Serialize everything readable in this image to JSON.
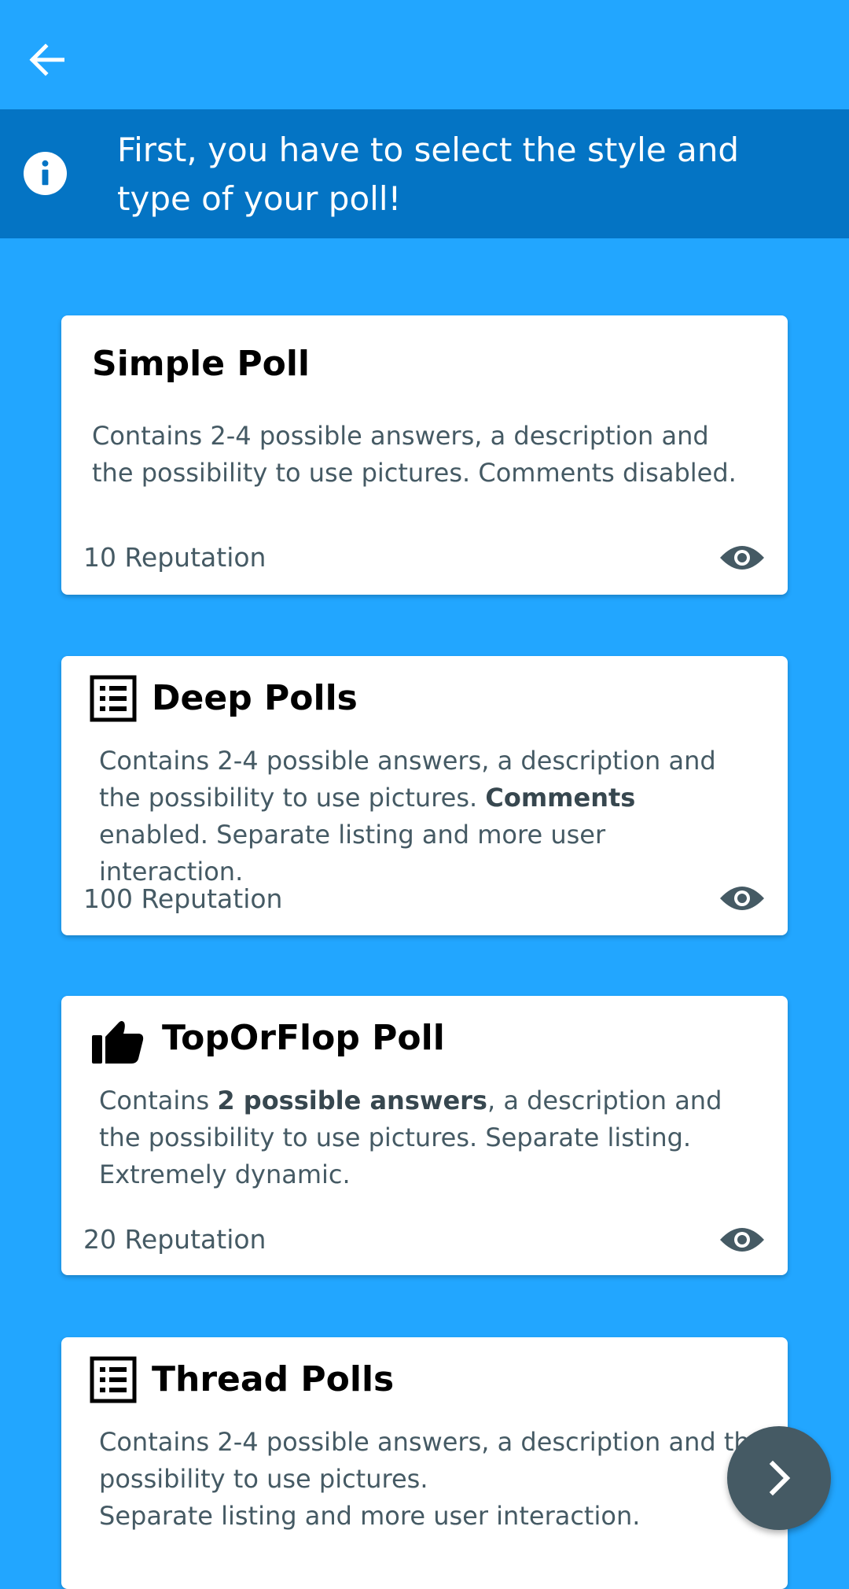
{
  "banner": {
    "text": "First, you have to select the style and type of your poll!"
  },
  "cards": [
    {
      "title": "Simple Poll",
      "description": "Contains 2-4 possible answers, a description and the possibility to use pictures. Comments disabled.",
      "reputation": "10 Reputation"
    },
    {
      "title": "Deep Polls",
      "description_parts": [
        "Contains 2-4 possible answers, a description and the possibility to use pictures. ",
        "Comments",
        " enabled. Separate listing and more user interaction."
      ],
      "reputation": "100 Reputation"
    },
    {
      "title": "TopOrFlop Poll",
      "description_parts": [
        "Contains ",
        "2 possible answers",
        ", a description and the possibility to use pictures. Separate listing. Extremely dynamic."
      ],
      "reputation": "20 Reputation"
    },
    {
      "title": "Thread Polls",
      "description_lines": [
        "Contains 2-4 possible answers, a description and the",
        "possibility to use pictures.",
        "Separate listing and more user interaction."
      ]
    }
  ],
  "icons": {
    "back": "arrow-left-icon",
    "info": "info-icon",
    "preview": "eye-icon",
    "list": "list-icon",
    "thumb": "thumb-up-icon",
    "next": "chevron-right-icon"
  },
  "colors": {
    "background": "#22A6FF",
    "banner": "#0474C4",
    "fab": "#455A64"
  }
}
